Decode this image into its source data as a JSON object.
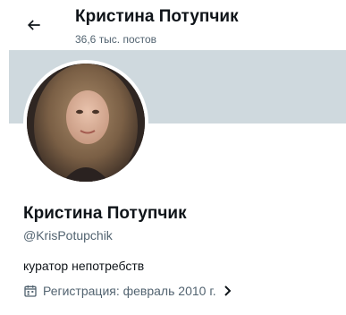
{
  "header": {
    "title": "Кристина Потупчик",
    "post_count": "36,6 тыс. постов"
  },
  "profile": {
    "name": "Кристина Потупчик",
    "handle": "@KrisPotupchik",
    "bio": "куратор непотребств",
    "joined": "Регистрация: февраль 2010 г."
  },
  "icons": {
    "back": "back-arrow-icon",
    "calendar": "calendar-icon",
    "chevron": "chevron-right-icon"
  },
  "colors": {
    "text_primary": "#0f1419",
    "text_secondary": "#536471",
    "banner": "#cfd9de"
  }
}
